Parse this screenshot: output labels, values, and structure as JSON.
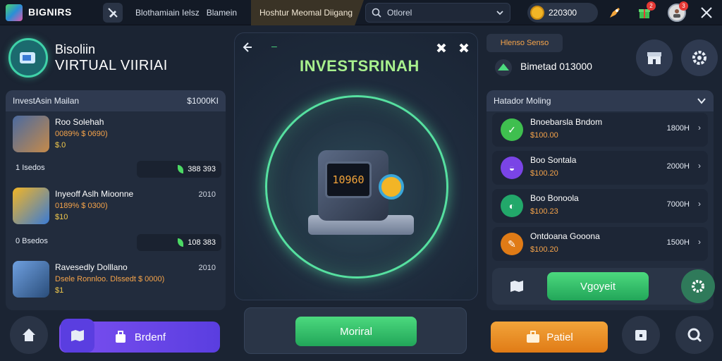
{
  "header": {
    "app_title": "BIGNIRS",
    "tabs": [
      {
        "label": "Blothamiain Ielsz"
      },
      {
        "label": "Blamein"
      },
      {
        "label": "Hoshtur Meomal Diigang"
      }
    ],
    "search_value": "Otlorel",
    "coins": "220300",
    "badge_1": "2",
    "badge_2": "3"
  },
  "profile": {
    "line1": "Bisoliin",
    "line2": "VIRTUAL VIIRIAI"
  },
  "left_panel": {
    "title": "InvestAsin Mailan",
    "amount": "$1000KI",
    "items": [
      {
        "name": "Roo Solehah",
        "stat": "0089% $ 0690)",
        "value": "$.0",
        "right": ""
      },
      {
        "name": "Inyeoff Aslh Mioonne",
        "stat": "0189% $ 0300)",
        "value": "$10",
        "right": "2010"
      },
      {
        "name": "Ravesedly Dolllano",
        "stat": "Dsele Ronnloo. Dlssedt $ 0000)",
        "value": "$1",
        "right": "2010"
      }
    ],
    "rows": [
      {
        "label": "Isedos",
        "value": "388 393"
      },
      {
        "label": "0 Bsedos",
        "value": "108 383"
      }
    ],
    "row1_prefix": "1"
  },
  "center": {
    "title": "INVESTSRINAH",
    "screen_value": "10960",
    "button_label": "Moriral"
  },
  "right_top": {
    "label": "Hlenso Senso",
    "balance": "Bimetad 013000"
  },
  "right_panel": {
    "title": "Hatador Moling",
    "items": [
      {
        "name": "Bnoebarsla Bndom",
        "sub": "$100.00",
        "amount": "1800H",
        "color": "#3fbf4f"
      },
      {
        "name": "Boo Sontala",
        "sub": "$100.20",
        "amount": "2000H",
        "color": "#7a44e6"
      },
      {
        "name": "Boo Bonoola",
        "sub": "$100.23",
        "amount": "7000H",
        "color": "#22a86a"
      },
      {
        "name": "Ontdoana Gooona",
        "sub": "$100.20",
        "amount": "1500H",
        "color": "#e07b16"
      }
    ],
    "footer_button": "Vgoyeit"
  },
  "bottom": {
    "purple_button": "Brdenf",
    "orange_button": "Patiel"
  },
  "colors": {
    "accent_green": "#4cd97e",
    "accent_orange": "#f6a44a",
    "accent_purple": "#7b4ff0",
    "background": "#1b2433"
  },
  "icons": [
    "cube-logo-icon",
    "pencil-off-icon",
    "search-icon",
    "chevron-down-icon",
    "coin-icon",
    "rocket-icon",
    "gift-icon",
    "avatar-icon",
    "close-icon",
    "back-arrow-icon",
    "puzzle-icon",
    "machine-icon",
    "store-icon",
    "settings-gear-icon",
    "home-icon",
    "map-icon",
    "bag-icon",
    "calendar-icon"
  ]
}
